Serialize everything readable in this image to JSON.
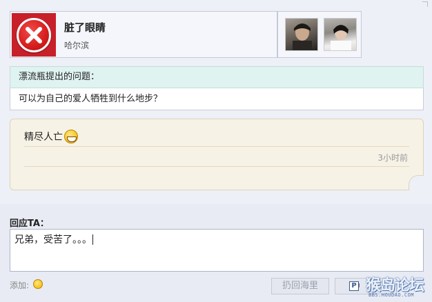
{
  "profile": {
    "name": "脏了眼睛",
    "city": "哈尔滨",
    "avatar_icon": "red-x-icon"
  },
  "photos": [
    {
      "icon": "user-photo-dark"
    },
    {
      "icon": "user-photo-light"
    }
  ],
  "question": {
    "header": "漂流瓶提出的问题：",
    "text": "可以为自己的爱人牺牲到什么地步？"
  },
  "answer": {
    "text": "精尽人亡",
    "emoji": "grin-emoji",
    "time": "3小时前"
  },
  "reply": {
    "label": "回应TA：",
    "value": "兄弟，受苦了。。。",
    "add_label": "添加:",
    "add_emoji_icon": "smiley-icon",
    "throw_button": "扔回海里",
    "second_button": "中"
  },
  "watermark": {
    "main": "猴岛论坛",
    "sub": "BBS.HOUDAO.COM"
  },
  "colors": {
    "page_bg": "#e8ebf4",
    "question_header_bg": "#dff3f1",
    "answer_bg": "#f7f2e6",
    "accent_red": "#c8202a"
  }
}
